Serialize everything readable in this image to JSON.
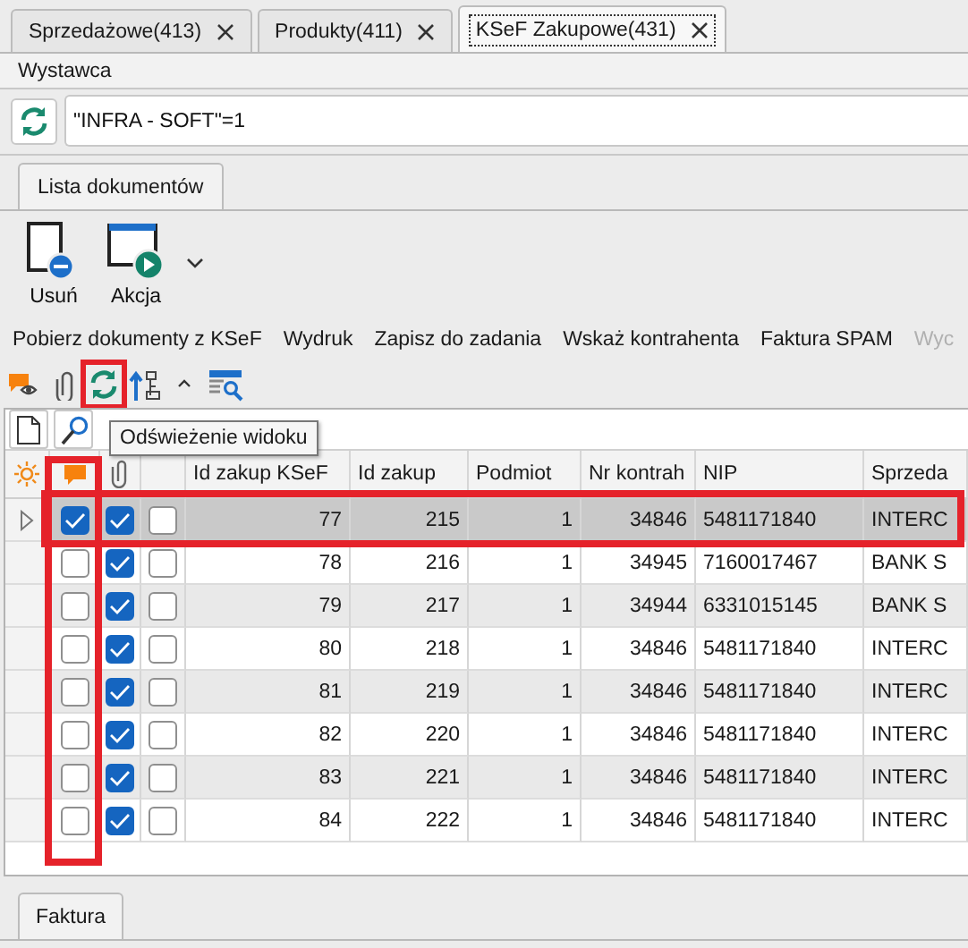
{
  "document_tabs": [
    {
      "label": "Sprzedażowe(413)",
      "selected": false
    },
    {
      "label": "Produkty(411)",
      "selected": false
    },
    {
      "label": "KSeF Zakupowe(431)",
      "selected": true
    }
  ],
  "section_label": "Wystawca",
  "filter": {
    "value": "\"INFRA - SOFT\"=1"
  },
  "panel_tabs": [
    {
      "label": "Lista dokumentów",
      "selected": true
    }
  ],
  "ribbon_buttons": [
    {
      "label": "Usuń",
      "kind": "delete"
    },
    {
      "label": "Akcja",
      "kind": "action"
    }
  ],
  "menu": [
    {
      "label": "Pobierz dokumenty z KSeF",
      "disabled": false
    },
    {
      "label": "Wydruk",
      "disabled": false
    },
    {
      "label": "Zapisz do zadania",
      "disabled": false
    },
    {
      "label": "Wskaż kontrahenta",
      "disabled": false
    },
    {
      "label": "Faktura SPAM",
      "disabled": false
    },
    {
      "label": "Wyc",
      "disabled": true
    }
  ],
  "tools": [
    {
      "kind": "comment-view",
      "highlighted": false
    },
    {
      "kind": "attach",
      "highlighted": false
    },
    {
      "kind": "refresh",
      "highlighted": true
    },
    {
      "kind": "sort",
      "highlighted": false
    },
    {
      "kind": "collapse",
      "highlighted": false
    },
    {
      "kind": "table-search",
      "highlighted": false
    }
  ],
  "tooltip": "Odświeżenie widoku",
  "table": {
    "comment_column_highlighted": true,
    "columns": [
      "Id zakup KSeF",
      "Id zakup",
      "Podmiot",
      "Nr kontrah",
      "NIP",
      "Sprzeda"
    ],
    "rows": [
      {
        "selected": true,
        "highlighted": true,
        "comment": true,
        "attachment": true,
        "flag": false,
        "cells": [
          "77",
          "215",
          "1",
          "34846",
          "5481171840",
          "INTERC"
        ]
      },
      {
        "selected": false,
        "highlighted": false,
        "comment": false,
        "attachment": true,
        "flag": false,
        "cells": [
          "78",
          "216",
          "1",
          "34945",
          "7160017467",
          "BANK S"
        ]
      },
      {
        "selected": false,
        "highlighted": false,
        "comment": false,
        "attachment": true,
        "flag": false,
        "cells": [
          "79",
          "217",
          "1",
          "34944",
          "6331015145",
          "BANK S"
        ]
      },
      {
        "selected": false,
        "highlighted": false,
        "comment": false,
        "attachment": true,
        "flag": false,
        "cells": [
          "80",
          "218",
          "1",
          "34846",
          "5481171840",
          "INTERC"
        ]
      },
      {
        "selected": false,
        "highlighted": false,
        "comment": false,
        "attachment": true,
        "flag": false,
        "cells": [
          "81",
          "219",
          "1",
          "34846",
          "5481171840",
          "INTERC"
        ]
      },
      {
        "selected": false,
        "highlighted": false,
        "comment": false,
        "attachment": true,
        "flag": false,
        "cells": [
          "82",
          "220",
          "1",
          "34846",
          "5481171840",
          "INTERC"
        ]
      },
      {
        "selected": false,
        "highlighted": false,
        "comment": false,
        "attachment": true,
        "flag": false,
        "cells": [
          "83",
          "221",
          "1",
          "34846",
          "5481171840",
          "INTERC"
        ]
      },
      {
        "selected": false,
        "highlighted": false,
        "comment": false,
        "attachment": true,
        "flag": false,
        "cells": [
          "84",
          "222",
          "1",
          "34846",
          "5481171840",
          "INTERC"
        ]
      }
    ]
  },
  "bottom_tabs": [
    {
      "label": "Faktura",
      "selected": true
    }
  ]
}
